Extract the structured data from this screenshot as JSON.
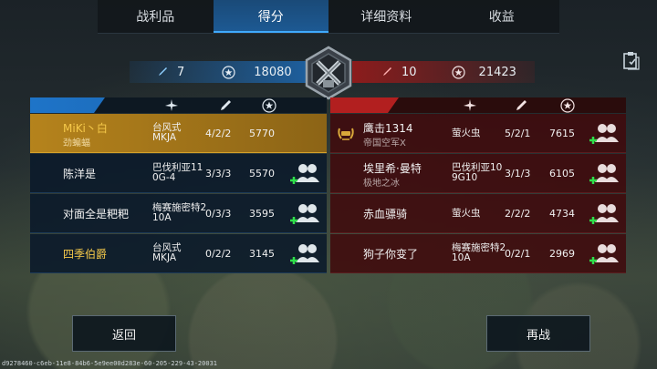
{
  "tabs": [
    "战利品",
    "得分",
    "详细资料",
    "收益"
  ],
  "active_tab": "得分",
  "summary": {
    "left_kills": "7",
    "left_score": "18080",
    "right_kills": "10",
    "right_score": "21423"
  },
  "icons": {
    "plane": "plane-icon",
    "kills": "missile-icon",
    "score": "star-badge-icon",
    "add_friend": "add-friend-icon",
    "clipboard": "clipboard-icon",
    "rank": "rank-emblem-icon",
    "mvp": "laurel-badge-icon"
  },
  "colors": {
    "blue_team": "#1e74c8",
    "red_team": "#b21f1f",
    "self_row": "#b5831c",
    "name_gold": "#f5c94a",
    "friend_green": "#2ee04a"
  },
  "left_team": [
    {
      "name": "MiKi丶白",
      "sub": "劲蝙蝠",
      "plane1": "台风式",
      "plane2": "MKJA",
      "kda": "4/2/2",
      "score": "5770",
      "self": true,
      "friend": false
    },
    {
      "name": "陈洋是",
      "sub": "",
      "plane1": "巴伐利亚11",
      "plane2": "0G-4",
      "kda": "3/3/3",
      "score": "5570",
      "self": false,
      "friend": true
    },
    {
      "name": "对面全是粑粑",
      "sub": "",
      "plane1": "梅赛施密特2",
      "plane2": "10A",
      "kda": "0/3/3",
      "score": "3595",
      "self": false,
      "friend": true
    },
    {
      "name": "四季伯爵",
      "sub": "",
      "plane1": "台风式",
      "plane2": "MKJA",
      "kda": "0/2/2",
      "score": "3145",
      "self": false,
      "friend": true,
      "gold": true
    }
  ],
  "right_team": [
    {
      "name": "鹰击1314",
      "sub": "帝国空军X",
      "plane1": "萤火虫",
      "plane2": "",
      "kda": "5/2/1",
      "score": "7615",
      "badge": true
    },
    {
      "name": "埃里希·曼特",
      "sub": "极地之冰",
      "plane1": "巴伐利亚10",
      "plane2": "9G10",
      "kda": "3/1/3",
      "score": "6105"
    },
    {
      "name": "赤血骠骑",
      "sub": "",
      "plane1": "萤火虫",
      "plane2": "",
      "kda": "2/2/2",
      "score": "4734"
    },
    {
      "name": "狗子你变了",
      "sub": "",
      "plane1": "梅赛施密特2",
      "plane2": "10A",
      "kda": "0/2/1",
      "score": "2969"
    }
  ],
  "buttons": {
    "back": "返回",
    "rematch": "再战"
  },
  "footer_id": "d9278460-c6eb-11e8-84b6-5e9ee00d283e-60-205-229-43-20031"
}
